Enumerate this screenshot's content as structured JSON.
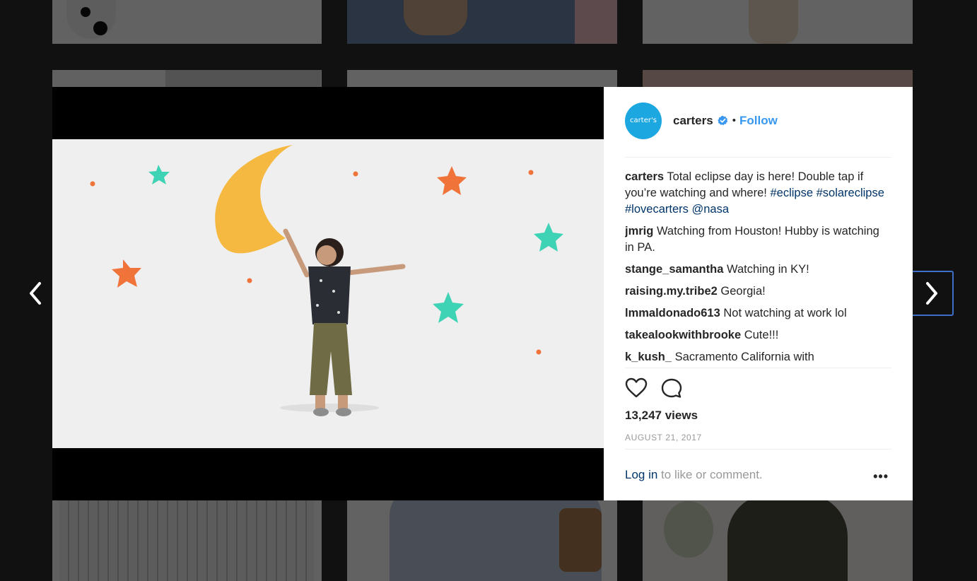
{
  "modal": {
    "author": {
      "avatar_text": "carter's",
      "username": "carters",
      "verified": true,
      "separator": "•",
      "follow_label": "Follow"
    },
    "caption": {
      "user": "carters",
      "text": "Total eclipse day is here! Double tap if you’re watching and where!",
      "tags": [
        "#eclipse",
        "#solareclipse",
        "#lovecarters",
        "@nasa"
      ]
    },
    "comments": [
      {
        "user": "jmrig",
        "text": "Watching from Houston! Hubby is watching in PA."
      },
      {
        "user": "stange_samantha",
        "text": "Watching in KY!"
      },
      {
        "user": "raising.my.tribe2",
        "text": "Georgia!"
      },
      {
        "user": "lmmaldonado613",
        "text": "Not watching at work lol"
      },
      {
        "user": "takealookwithbrooke",
        "text": "Cute!!!"
      },
      {
        "user": "k_kush_",
        "text": "Sacramento California with"
      }
    ],
    "views": "13,247 views",
    "date": "AUGUST 21, 2017",
    "login_link": "Log in",
    "login_text": " to like or comment.",
    "more_label": "•••"
  },
  "icons": {
    "like": "heart-icon",
    "comment": "comment-icon",
    "prev": "chevron-left-icon",
    "next": "chevron-right-icon",
    "verified": "verified-badge-icon"
  },
  "colors": {
    "accent": "#3897f0",
    "tag": "#003569",
    "avatar": "#1da7e0",
    "moon": "#f5b942",
    "star_orange": "#f0743a",
    "star_teal": "#3fd3b6"
  }
}
